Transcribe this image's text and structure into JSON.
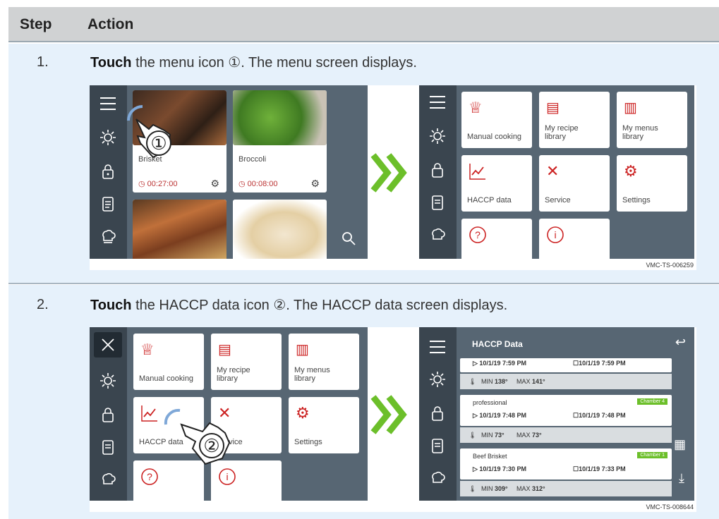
{
  "header": {
    "step": "Step",
    "action": "Action"
  },
  "steps": [
    {
      "num": "1.",
      "bold": "Touch",
      "text": " the menu icon ①. The menu screen displays.",
      "code": "VMC-TS-006259",
      "left_tiles": [
        {
          "name": "Brisket",
          "time": "00:27:00"
        },
        {
          "name": "Broccoli",
          "time": "00:08:00"
        }
      ],
      "menu": {
        "manual": "Manual cooking",
        "recipe": "My recipe library",
        "menus": "My menus library",
        "haccp": "HACCP data",
        "service": "Service",
        "settings": "Settings"
      }
    },
    {
      "num": "2.",
      "bold": "Touch",
      "text": " the HACCP data icon ②. The HACCP data screen displays.",
      "code": "VMC-TS-008644",
      "menu": {
        "manual": "Manual cooking",
        "recipe": "My recipe library",
        "menus": "My menus library",
        "haccp": "HACCP data",
        "service": "Service",
        "settings": "Settings"
      },
      "haccp": {
        "title": "HACCP Data",
        "entries": [
          {
            "name": "",
            "start": "10/1/19 7:59 PM",
            "end": "10/1/19 7:59 PM",
            "min": "138°",
            "max": "141°"
          },
          {
            "name": "professional",
            "badge": "Chamber 4",
            "start": "10/1/19 7:48 PM",
            "end": "10/1/19 7:48 PM",
            "min": "73°",
            "max": "73°"
          },
          {
            "name": "Beef Brisket",
            "badge": "Chamber 1",
            "start": "10/1/19 7:30 PM",
            "end": "10/1/19 7:33 PM",
            "min": "309°",
            "max": "312°"
          }
        ]
      }
    }
  ],
  "labels": {
    "min": "MIN",
    "max": "MAX",
    "marker1": "①",
    "marker2": "②"
  },
  "colors": {
    "accent_green": "#6cbf2a",
    "screen_bg": "#576673",
    "sidebar": "#3a454f",
    "row_bg": "#e6f1fb"
  }
}
